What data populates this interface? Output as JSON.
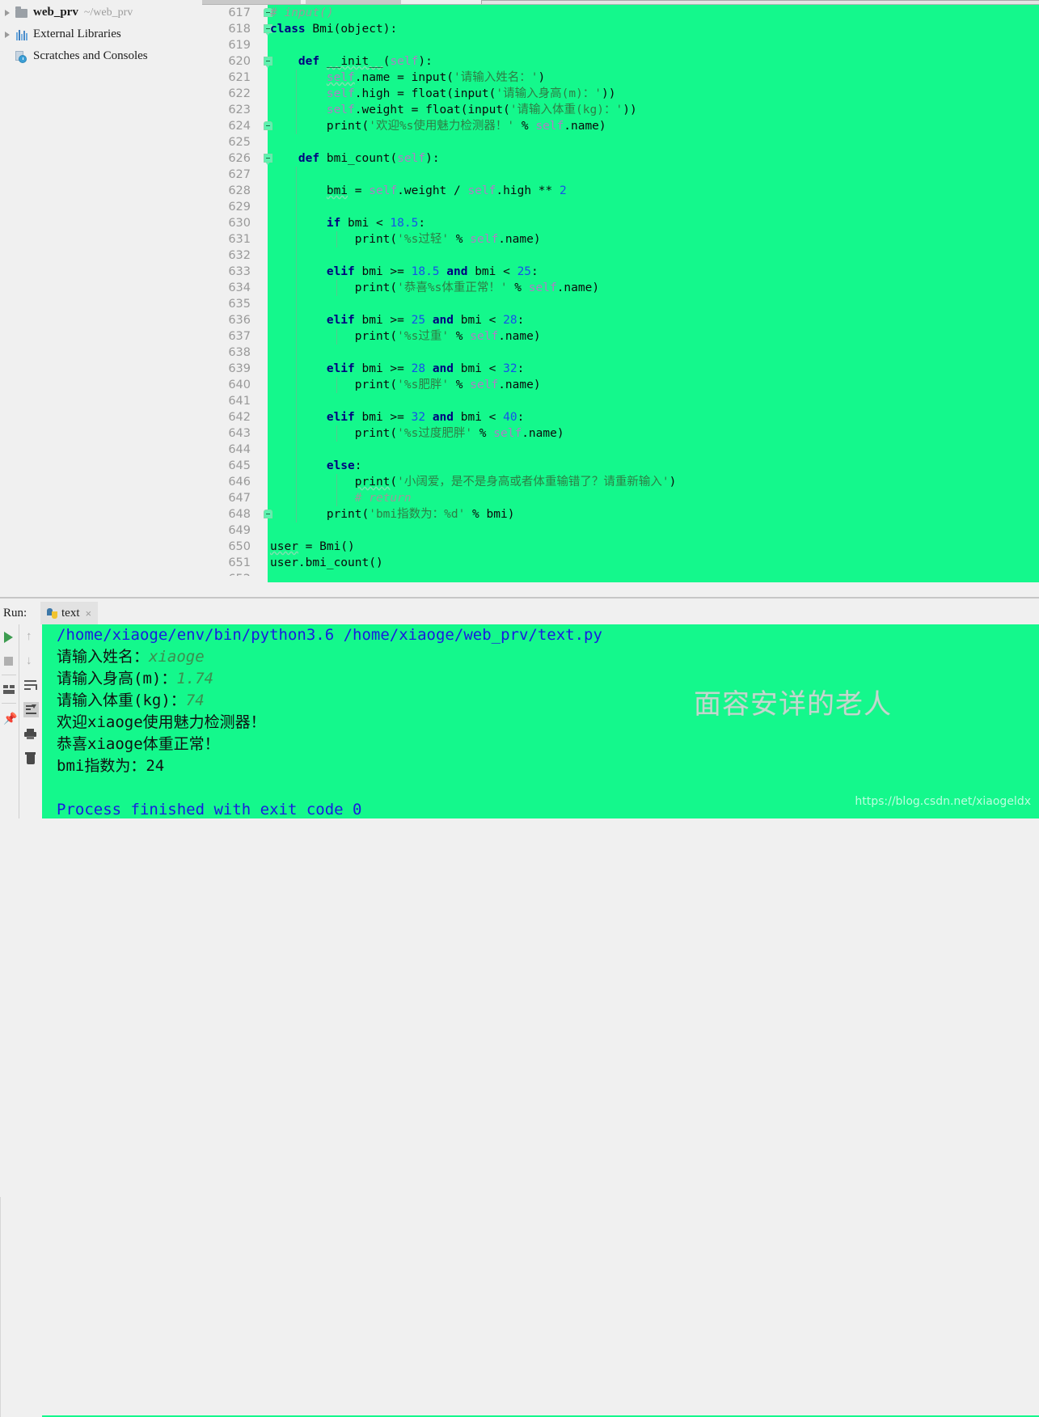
{
  "project": {
    "items": [
      {
        "label": "web_prv",
        "path": "~/web_prv",
        "icon": "folder-icon",
        "expandable": true
      },
      {
        "label": "External Libraries",
        "path": "",
        "icon": "libraries-icon",
        "expandable": true
      },
      {
        "label": "Scratches and Consoles",
        "path": "",
        "icon": "scratches-icon",
        "expandable": false
      }
    ]
  },
  "editor": {
    "first_line": 617,
    "last_partial_line": 652,
    "background_color": "#14F88C",
    "gutter_color": "#F0F0F0",
    "lines": [
      {
        "n": 617,
        "text": "# input()"
      },
      {
        "n": 618,
        "text": "class Bmi(object):"
      },
      {
        "n": 619,
        "text": ""
      },
      {
        "n": 620,
        "text": "    def __init__(self):"
      },
      {
        "n": 621,
        "text": "        self.name = input('请输入姓名：')"
      },
      {
        "n": 622,
        "text": "        self.high = float(input('请输入身高(m)：'))"
      },
      {
        "n": 623,
        "text": "        self.weight = float(input('请输入体重(kg)：'))"
      },
      {
        "n": 624,
        "text": "        print('欢迎%s使用魅力检测器！' % self.name)"
      },
      {
        "n": 625,
        "text": ""
      },
      {
        "n": 626,
        "text": "    def bmi_count(self):"
      },
      {
        "n": 627,
        "text": ""
      },
      {
        "n": 628,
        "text": "        bmi = self.weight / self.high ** 2"
      },
      {
        "n": 629,
        "text": ""
      },
      {
        "n": 630,
        "text": "        if bmi < 18.5:"
      },
      {
        "n": 631,
        "text": "            print('%s过轻' % self.name)"
      },
      {
        "n": 632,
        "text": ""
      },
      {
        "n": 633,
        "text": "        elif bmi >= 18.5 and bmi < 25:"
      },
      {
        "n": 634,
        "text": "            print('恭喜%s体重正常！' % self.name)"
      },
      {
        "n": 635,
        "text": ""
      },
      {
        "n": 636,
        "text": "        elif bmi >= 25 and bmi < 28:"
      },
      {
        "n": 637,
        "text": "            print('%s过重' % self.name)"
      },
      {
        "n": 638,
        "text": ""
      },
      {
        "n": 639,
        "text": "        elif bmi >= 28 and bmi < 32:"
      },
      {
        "n": 640,
        "text": "            print('%s肥胖' % self.name)"
      },
      {
        "n": 641,
        "text": ""
      },
      {
        "n": 642,
        "text": "        elif bmi >= 32 and bmi < 40:"
      },
      {
        "n": 643,
        "text": "            print('%s过度肥胖' % self.name)"
      },
      {
        "n": 644,
        "text": ""
      },
      {
        "n": 645,
        "text": "        else:"
      },
      {
        "n": 646,
        "text": "            print('小阔爱，是不是身高或者体重输错了？请重新输入')"
      },
      {
        "n": 647,
        "text": "            # return"
      },
      {
        "n": 648,
        "text": "        print('bmi指数为：%d' % bmi)"
      },
      {
        "n": 649,
        "text": ""
      },
      {
        "n": 650,
        "text": "user = Bmi()"
      },
      {
        "n": 651,
        "text": "user.bmi_count()"
      }
    ],
    "tokens": {
      "comment_617": "# input()",
      "kw_class": "class",
      "classname": "Bmi",
      "kw_object": "object",
      "kw_def": "def",
      "name_init": "__init__",
      "kw_self": "self",
      "str_name_prompt": "'请输入姓名：'",
      "str_high_prompt": "'请输入身高(m)：'",
      "str_weight_prompt": "'请输入体重(kg)：'",
      "str_welcome": "'欢迎%s使用魅力检测器！'",
      "name_bmi_count": "bmi_count",
      "kw_if": "if",
      "kw_elif": "elif",
      "kw_else": "else",
      "kw_and": "and",
      "str_light": "'%s过轻'",
      "str_normal": "'恭喜%s体重正常！'",
      "str_over": "'%s过重'",
      "str_fat": "'%s肥胖'",
      "str_veryfat": "'%s过度肥胖'",
      "str_wrong": "'小阔爱，是不是身高或者体重输错了？请重新输入'",
      "comment_return": "# return",
      "str_index": "'bmi指数为：%d'",
      "num_185": "18.5",
      "num_25": "25",
      "num_28": "28",
      "num_32": "32",
      "num_40": "40",
      "num_2": "2"
    }
  },
  "run_panel": {
    "label": "Run:",
    "tab": {
      "title": "text",
      "close": "×",
      "icon": "python-icon"
    },
    "left_toolbar": [
      {
        "name": "rerun-button",
        "icon": "play-icon"
      },
      {
        "name": "stop-button",
        "icon": "stop-icon"
      },
      {
        "name": "layout-button",
        "icon": "layout-icon"
      },
      {
        "name": "pin-tab-button",
        "icon": "pin-icon"
      }
    ],
    "right_toolbar": [
      {
        "name": "up-button",
        "icon": "arrow-up-icon"
      },
      {
        "name": "down-button",
        "icon": "arrow-down-icon"
      },
      {
        "name": "soft-wrap-button",
        "icon": "soft-wrap-icon"
      },
      {
        "name": "scroll-to-end-button",
        "icon": "scroll-to-end-icon",
        "active": true
      },
      {
        "name": "print-button",
        "icon": "print-icon"
      },
      {
        "name": "clear-all-button",
        "icon": "trash-icon"
      }
    ],
    "console": {
      "command": "/home/xiaoge/env/bin/python3.6 /home/xiaoge/web_prv/text.py",
      "rows": [
        {
          "prompt": "请输入姓名：",
          "value": "xiaoge"
        },
        {
          "prompt": "请输入身高(m)：",
          "value": "1.74"
        },
        {
          "prompt": "请输入体重(kg)：",
          "value": "74"
        }
      ],
      "outputs": [
        "欢迎xiaoge使用魅力检测器！",
        "恭喜xiaoge体重正常！",
        "bmi指数为：24"
      ],
      "exit_line": "Process finished with exit code 0"
    }
  },
  "watermarks": {
    "nickname": "面容安详的老人",
    "url": "https://blog.csdn.net/xiaogeldx"
  }
}
